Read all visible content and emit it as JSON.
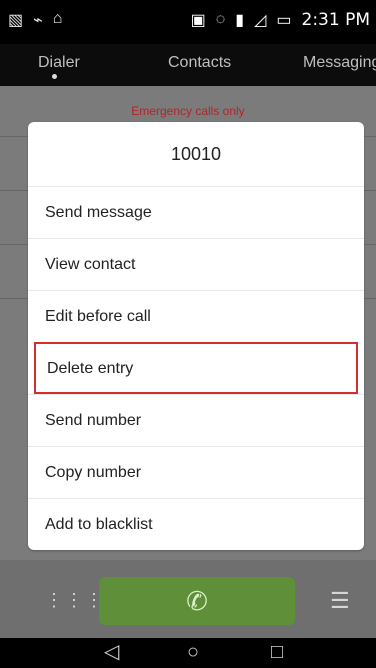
{
  "status_bar": {
    "time": "2:31 PM",
    "left_icons": [
      "image-icon",
      "wifi-icon",
      "usb-icon"
    ],
    "right_icons": [
      "nfc-icon",
      "silent-icon",
      "vibrate-icon",
      "no-signal-icon",
      "battery-icon"
    ]
  },
  "tabs": [
    {
      "label": "Dialer"
    },
    {
      "label": "Contacts"
    },
    {
      "label": "Messaging"
    }
  ],
  "emergency_text": "Emergency calls only",
  "dialog": {
    "title": "10010",
    "items": [
      {
        "label": "Send message"
      },
      {
        "label": "View contact"
      },
      {
        "label": "Edit before call"
      },
      {
        "label": "Delete entry"
      },
      {
        "label": "Send number"
      },
      {
        "label": "Copy number"
      },
      {
        "label": "Add to blacklist"
      }
    ],
    "highlight_color": "#d32f2f"
  },
  "bottom": {
    "keypad_icon": "keypad-icon",
    "call_icon": "phone-icon",
    "menu_icon": "menu-icon"
  },
  "nav": {
    "icons": [
      "back-icon",
      "home-icon",
      "recent-apps-icon"
    ]
  }
}
